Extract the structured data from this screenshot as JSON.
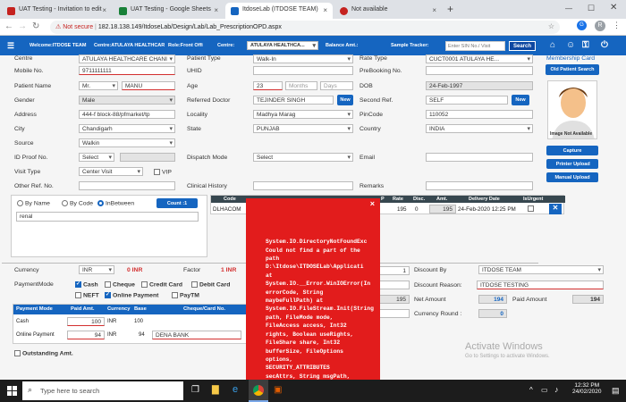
{
  "browser": {
    "tabs": [
      {
        "label": "UAT Testing - Invitation to edit",
        "color": "#c5221f"
      },
      {
        "label": "UAT Testing - Google Sheets",
        "color": "#188038"
      },
      {
        "label": "ItdoseLab (ITDOSE TEAM)",
        "color": "#1565c0"
      },
      {
        "label": "Not available",
        "color": "#c5221f"
      }
    ],
    "security": "Not secure",
    "url": "182.18.138.149/ItdoseLab/Design/Lab/Lab_PrescriptionOPD.aspx",
    "profile": "R"
  },
  "nav": {
    "welcome": "Welcome:ITDOSE TEAM",
    "centre": "Centre:ATULAYA HEALTHCAR",
    "role": "Role:Front Offi",
    "centre_label": "Centre:",
    "centre_value": "ATULAYA HEALTHCA...",
    "balance": "Balance Amt.:",
    "tracker": "Sample Tracker:",
    "search_placeholder": "Enter SIN No./ Visit",
    "search_btn": "Search"
  },
  "form": {
    "centre_l": "Centre",
    "centre_v": "ATULAYA HEALTHCARE CHANI",
    "mobile_l": "Mobile No.",
    "mobile_v": "9711111111",
    "pname_l": "Patient Name",
    "title_v": "Mr.",
    "pname_v": "MANU",
    "gender_l": "Gender",
    "gender_v": "Male",
    "address_l": "Address",
    "address_v": "444-f block-88/pfmarket/tp",
    "city_l": "City",
    "city_v": "Chandigarh",
    "source_l": "Source",
    "source_v": "Walkin",
    "idproof_l": "ID Proof No.",
    "idproof_v": "Select",
    "visit_l": "Visit Type",
    "visit_v": "Center Visit",
    "vip_l": "VIP",
    "other_l": "Other Ref. No.",
    "ptype_l": "Patient Type",
    "ptype_v": "Walk-In",
    "uhid_l": "UHID",
    "age_l": "Age",
    "age_v": "23",
    "months_p": "Months",
    "days_p": "Days",
    "refdoc_l": "Referred Doctor",
    "refdoc_v": "TEJINDER SINGH",
    "new_btn": "New",
    "locality_l": "Locality",
    "locality_v": "Madhya Marag",
    "state_l": "State",
    "state_v": "PUNJAB",
    "dispatch_l": "Dispatch Mode",
    "dispatch_v": "Select",
    "clinical_l": "Clinical History",
    "rate_l": "Rate Type",
    "rate_v": "CUCT0001 ATULAYA HE...",
    "prebook_l": "PreBooking No.",
    "dob_l": "DOB",
    "dob_v": "24-Feb-1997",
    "second_l": "Second Ref.",
    "second_v": "SELF",
    "pincode_l": "PinCode",
    "pincode_v": "110052",
    "country_l": "Country",
    "country_v": "INDIA",
    "email_l": "Email",
    "remarks_l": "Remarks"
  },
  "side": {
    "membership": "Membership Card",
    "old_search": "Old Patient Search",
    "img_na": "Image Not Available",
    "capture": "Capture",
    "printer": " Printer Upload",
    "manual": "Manual Upload"
  },
  "tests": {
    "by_name": "By Name",
    "by_code": "By Code",
    "in_between": "InBetween",
    "count": "Count :1",
    "search_v": "renal",
    "headers": [
      "Code",
      "P",
      "Rate",
      "Disc.",
      "Amt.",
      "Delivery Date",
      "IsUrgent"
    ],
    "row": {
      "code": "DLHACOM",
      "rate": "195",
      "disc": "0",
      "amt": "195",
      "delivery": "24-Feb-2020 12:25 PM"
    }
  },
  "payment": {
    "currency_l": "Currency",
    "currency_v": "INR",
    "zero_inr": "0 INR",
    "factor_l": "Factor",
    "factor_v": "1 INR",
    "mode_l": "PaymentMode",
    "modes": [
      "Cash",
      "Cheque",
      "Credit Card",
      "Debit Card",
      "NEFT",
      "Online Payment",
      "PayTM"
    ],
    "headers": [
      "Payment Mode",
      "Paid Amt.",
      "Currency",
      "Base",
      "Cheque/Card No."
    ],
    "rows": [
      {
        "mode": "Cash",
        "paid": "100",
        "cur": "INR",
        "base": "100",
        "card": ""
      },
      {
        "mode": "Online Payment",
        "paid": "94",
        "cur": "INR",
        "base": "94",
        "card": "DENA BANK"
      }
    ],
    "outstanding": "Outstanding Amt.",
    "one": "1",
    "blank_val": "195"
  },
  "discount": {
    "by_l": "Discount By",
    "by_v": "ITDOSE TEAM",
    "reason_l": "Discount Reason:",
    "reason_v": "ITDOSE TESTING",
    "net_l": "Net Amount",
    "net_v": "194",
    "paid_l": "Paid Amount",
    "paid_v": "194",
    "round_l": "Currency Round :",
    "round_v": "0"
  },
  "error": {
    "text": "System.IO.DirectoryNotFoundExc\nCould not find a part of the\npath\nD:\\Itdose\\ITDOSELab\\Applicati\nat\nSystem.IO.__Error.WinIOError(In\nerrorCode, String\nmaybeFullPath) at\nSystem.IO.FileStream.Init(String\npath, FileMode mode,\nFileAccess access, Int32\nrights, Boolean useRights,\nFileShare share, Int32\nbufferSize, FileOptions\noptions,\nSECURITY_ATTRIBUTES\nsecAttrs, String msgPath,\nBoolean bFromProxy, Boolean\nuseLongPath, Boolean\ncheckHost) at",
    "close": "×"
  },
  "watermark": {
    "title": "Activate Windows",
    "sub": "Go to Settings to activate Windows."
  },
  "taskbar": {
    "search": "Type here to search",
    "time": "12:32 PM",
    "date": "24/02/2020"
  }
}
